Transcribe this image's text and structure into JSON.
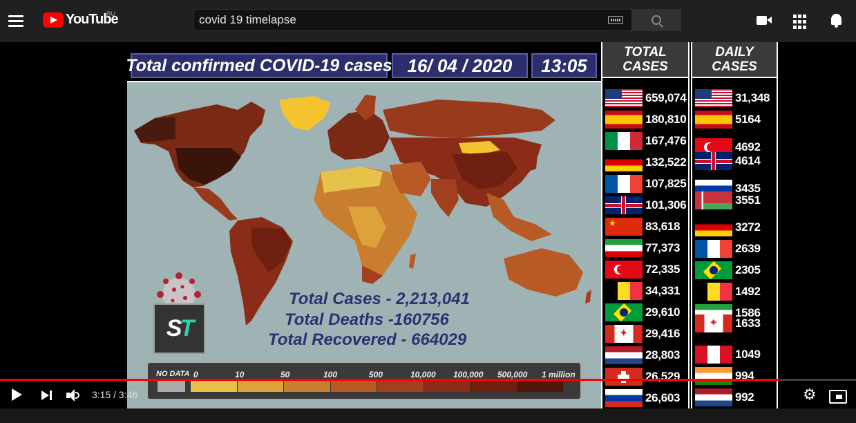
{
  "header": {
    "logo_text": "YouTube",
    "region": "RU",
    "search_value": "covid 19 timelapse",
    "search_placeholder": "Search"
  },
  "video": {
    "title_box": "Total confirmed COVID-19 cases",
    "date": "16/ 04 / 2020",
    "time": "13:05",
    "total_cases": "Total Cases - 2,213,041",
    "total_deaths": "Total Deaths -160756",
    "total_recovered": "Total Recovered - 664029",
    "logo_letters": [
      "S",
      "T"
    ],
    "legend": {
      "no_data": "NO DATA",
      "labels": [
        "0",
        "10",
        "50",
        "100",
        "500",
        "10,000",
        "100,000",
        "500,000",
        "1 million"
      ],
      "colors": [
        "#e6c24a",
        "#dba33a",
        "#c97d2e",
        "#b85a25",
        "#a2401e",
        "#8a2c17",
        "#6e1f10",
        "#4f160b"
      ]
    },
    "total_panel": {
      "header_line1": "TOTAL",
      "header_line2": "CASES",
      "rows": [
        {
          "flag": "us",
          "value": "659,074"
        },
        {
          "flag": "es",
          "value": "180,810"
        },
        {
          "flag": "it",
          "value": "167,476"
        },
        {
          "flag": "de",
          "value": "132,522"
        },
        {
          "flag": "fr",
          "value": "107,825"
        },
        {
          "flag": "uk",
          "value": "101,306"
        },
        {
          "flag": "cn",
          "value": "83,618"
        },
        {
          "flag": "ir",
          "value": "77,373"
        },
        {
          "flag": "tr",
          "value": "72,335"
        },
        {
          "flag": "be",
          "value": "34,331"
        },
        {
          "flag": "br",
          "value": "29,610"
        },
        {
          "flag": "ca",
          "value": "29,416"
        },
        {
          "flag": "nl",
          "value": "28,803"
        },
        {
          "flag": "ch",
          "value": "26,529"
        },
        {
          "flag": "ru",
          "value": "26,603"
        }
      ]
    },
    "daily_panel": {
      "header_line1": "DAILY",
      "header_line2": "CASES",
      "rows": [
        {
          "flag": "us",
          "value": "31,348"
        },
        {
          "flag": "es",
          "value": "5164"
        },
        {
          "flag": "tr",
          "value": "4692"
        },
        {
          "flag": "uk",
          "value": "4614"
        },
        {
          "flag": "ru",
          "value": "3435"
        },
        {
          "flag": "by",
          "value": "3551"
        },
        {
          "flag": "de",
          "value": "3272"
        },
        {
          "flag": "fr",
          "value": "2639"
        },
        {
          "flag": "br",
          "value": "2305"
        },
        {
          "flag": "be",
          "value": "1492"
        },
        {
          "flag": "ir",
          "value": "1586"
        },
        {
          "flag": "ca",
          "value": "1633"
        },
        {
          "flag": "pe",
          "value": "1049"
        },
        {
          "flag": "in",
          "value": "994"
        },
        {
          "flag": "nl",
          "value": "992"
        }
      ]
    }
  },
  "player": {
    "current_time": "3:15",
    "duration": "3:46",
    "time_display": "3:15 / 3:46",
    "progress": 0.91
  }
}
